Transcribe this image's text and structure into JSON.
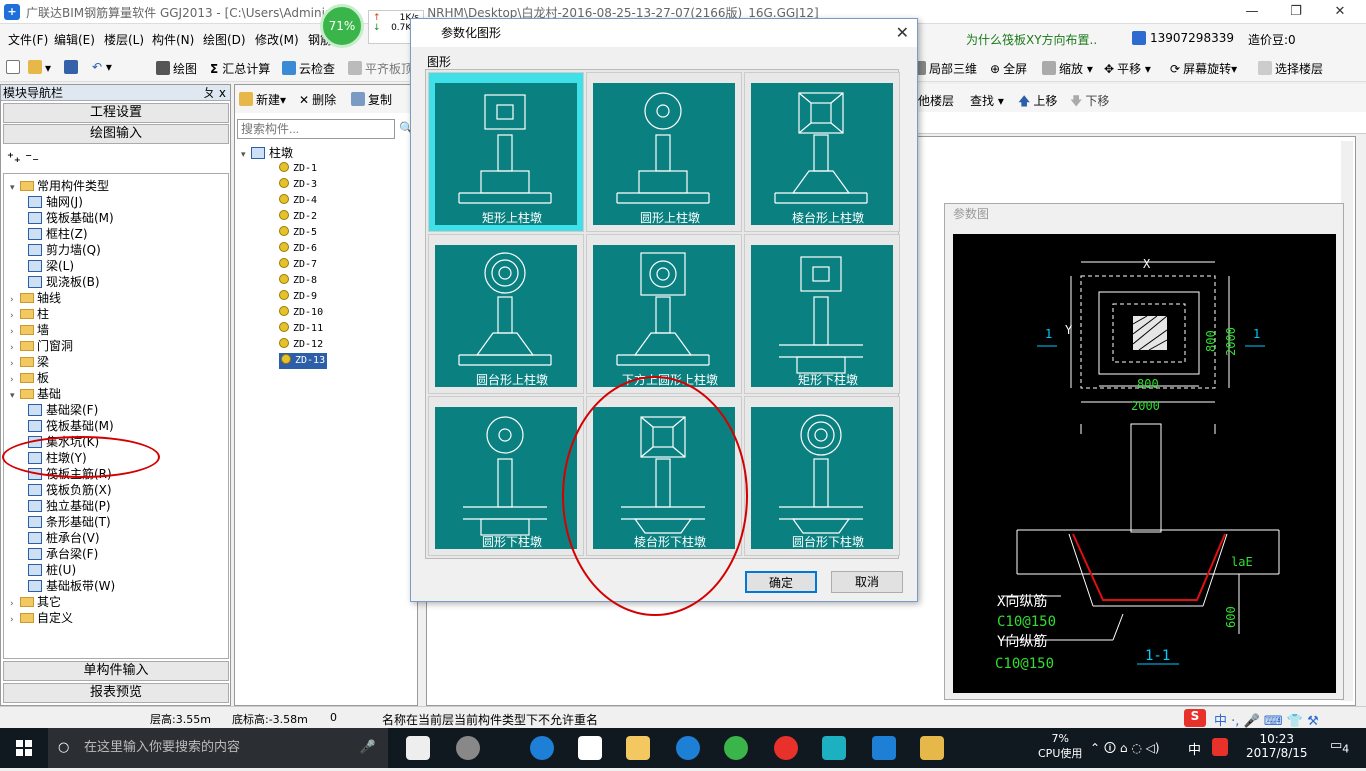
{
  "window": {
    "title": "广联达BIM钢筋算量软件 GGJ2013 - [C:\\Users\\Adminis",
    "title_right": "NRHM\\Desktop\\白龙村-2016-08-25-13-27-07(2166版)_16G.GGJ12]"
  },
  "menu": [
    "文件(F)",
    "编辑(E)",
    "楼层(L)",
    "构件(N)",
    "绘图(D)",
    "修改(M)",
    "钢筋"
  ],
  "menu_right": {
    "question": "为什么筏板XY方向布置..",
    "phone": "13907298339",
    "price": "造价豆:0"
  },
  "toolbar": {
    "draw": "绘图",
    "sum": "汇总计算",
    "cloud": "云检查",
    "flat": "平齐板顶",
    "local3d": "局部三维",
    "full": "全屏",
    "zoom": "缩放",
    "pan": "平移",
    "rotate": "屏幕旋转",
    "floor": "选择楼层"
  },
  "toolbar2": {
    "other_floor": "他楼层",
    "find": "查找",
    "up": "上移",
    "down": "下移"
  },
  "nav": {
    "header": "模块导航栏",
    "pin": "ㄆ x",
    "project": "工程设置",
    "drawing": "绘图输入",
    "single": "单构件输入",
    "report": "报表预览"
  },
  "tree": [
    {
      "label": "常用构件类型",
      "level": 0,
      "exp": "▾",
      "type": "folder"
    },
    {
      "label": "轴网(J)",
      "level": 1,
      "type": "item"
    },
    {
      "label": "筏板基础(M)",
      "level": 1,
      "type": "item"
    },
    {
      "label": "框柱(Z)",
      "level": 1,
      "type": "item"
    },
    {
      "label": "剪力墙(Q)",
      "level": 1,
      "type": "item"
    },
    {
      "label": "梁(L)",
      "level": 1,
      "type": "item"
    },
    {
      "label": "现浇板(B)",
      "level": 1,
      "type": "item"
    },
    {
      "label": "轴线",
      "level": 0,
      "exp": "›",
      "type": "folder"
    },
    {
      "label": "柱",
      "level": 0,
      "exp": "›",
      "type": "folder"
    },
    {
      "label": "墙",
      "level": 0,
      "exp": "›",
      "type": "folder"
    },
    {
      "label": "门窗洞",
      "level": 0,
      "exp": "›",
      "type": "folder"
    },
    {
      "label": "梁",
      "level": 0,
      "exp": "›",
      "type": "folder"
    },
    {
      "label": "板",
      "level": 0,
      "exp": "›",
      "type": "folder"
    },
    {
      "label": "基础",
      "level": 0,
      "exp": "▾",
      "type": "folder"
    },
    {
      "label": "基础梁(F)",
      "level": 1,
      "type": "item"
    },
    {
      "label": "筏板基础(M)",
      "level": 1,
      "type": "item"
    },
    {
      "label": "集水坑(K)",
      "level": 1,
      "type": "item"
    },
    {
      "label": "柱墩(Y)",
      "level": 1,
      "type": "item"
    },
    {
      "label": "筏板主筋(R)",
      "level": 1,
      "type": "item"
    },
    {
      "label": "筏板负筋(X)",
      "level": 1,
      "type": "item"
    },
    {
      "label": "独立基础(P)",
      "level": 1,
      "type": "item"
    },
    {
      "label": "条形基础(T)",
      "level": 1,
      "type": "item"
    },
    {
      "label": "桩承台(V)",
      "level": 1,
      "type": "item"
    },
    {
      "label": "承台梁(F)",
      "level": 1,
      "type": "item"
    },
    {
      "label": "桩(U)",
      "level": 1,
      "type": "item"
    },
    {
      "label": "基础板带(W)",
      "level": 1,
      "type": "item"
    },
    {
      "label": "其它",
      "level": 0,
      "exp": "›",
      "type": "folder"
    },
    {
      "label": "自定义",
      "level": 0,
      "exp": "›",
      "type": "folder"
    }
  ],
  "list": {
    "new": "新建",
    "delete": "删除",
    "copy": "复制",
    "search_placeholder": "搜索构件...",
    "root": "柱墩",
    "items": [
      "ZD-1",
      "ZD-3",
      "ZD-4",
      "ZD-2",
      "ZD-5",
      "ZD-6",
      "ZD-7",
      "ZD-8",
      "ZD-9",
      "ZD-10",
      "ZD-11",
      "ZD-12",
      "ZD-13"
    ],
    "selected": "ZD-13"
  },
  "dialog": {
    "title": "参数化图形",
    "group": "图形",
    "ok": "确定",
    "cancel": "取消",
    "shapes": [
      "矩形上柱墩",
      "圆形上柱墩",
      "棱台形上柱墩",
      "圆台形上柱墩",
      "下方上圆形上柱墩",
      "矩形下柱墩",
      "圆形下柱墩",
      "棱台形下柱墩",
      "圆台形下柱墩"
    ]
  },
  "param": {
    "title": "参数图",
    "x": "X",
    "y": "Y",
    "d800a": "800",
    "d2000a": "2000",
    "d800b": "800",
    "d2000b": "2000",
    "sec1": "1",
    "sec2": "1",
    "lae": "laE",
    "d600": "600",
    "xbar": "X向纵筋",
    "xspec": "C10@150",
    "ybar": "Y向纵筋",
    "yspec": "C10@150",
    "label11": "1-1"
  },
  "speed": {
    "percent": "71%",
    "up": "1K/s",
    "down": "0.7K/s"
  },
  "status": {
    "floor_h": "层高:3.55m",
    "bottom_h": "底标高:-3.58m",
    "num": "0",
    "msg": "名称在当前层当前构件类型下不允许重名"
  },
  "taskbar": {
    "search": "在这里输入你要搜索的内容",
    "cpu_pct": "7%",
    "cpu": "CPU使用",
    "ime": "中",
    "time": "10:23",
    "date": "2017/8/15",
    "notif": "4"
  },
  "colors": {
    "teal": "#0a8080",
    "selected": "#3fe0e8",
    "highlight": "#d40000"
  }
}
